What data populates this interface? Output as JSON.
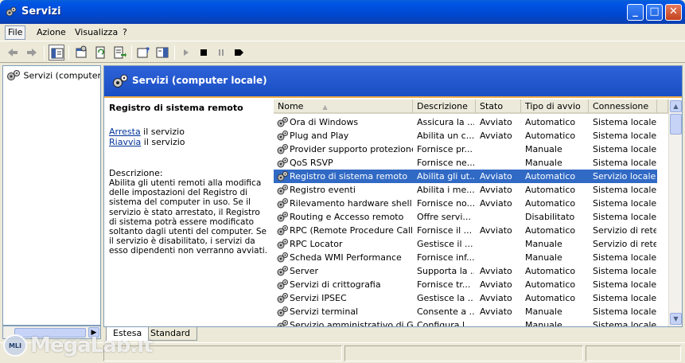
{
  "window": {
    "title": "Servizi"
  },
  "menu": [
    {
      "label": "File"
    },
    {
      "label": "Azione"
    },
    {
      "label": "Visualizza"
    },
    {
      "label": "?"
    }
  ],
  "tree": {
    "root": "Servizi (computer locale)"
  },
  "panel": {
    "header": "Servizi (computer locale)",
    "selected_name": "Registro di sistema remoto",
    "link_stop": "Arresta",
    "link_stop_suffix": " il servizio",
    "link_restart": "Riavvia",
    "link_restart_suffix": " il servizio",
    "description_label": "Descrizione:",
    "description": "Abilita gli utenti remoti alla modifica delle impostazioni del Registro di sistema del computer in uso. Se il servizio è stato arrestato, il Registro di sistema potrà essere modificato soltanto dagli utenti del computer. Se il servizio è disabilitato, i servizi da esso dipendenti non verranno avviati."
  },
  "columns": [
    "Nome",
    "Descrizione",
    "Stato",
    "Tipo di avvio",
    "Connessione"
  ],
  "rows": [
    {
      "name": "Ora di Windows",
      "desc": "Assicura la ...",
      "stato": "Avviato",
      "tipo": "Automatico",
      "conn": "Sistema locale",
      "selected": false
    },
    {
      "name": "Plug and Play",
      "desc": "Abilita un c...",
      "stato": "Avviato",
      "tipo": "Automatico",
      "conn": "Sistema locale",
      "selected": false
    },
    {
      "name": "Provider supporto protezione...",
      "desc": "Fornisce pr...",
      "stato": "",
      "tipo": "Manuale",
      "conn": "Sistema locale",
      "selected": false
    },
    {
      "name": "QoS RSVP",
      "desc": "Fornisce ne...",
      "stato": "",
      "tipo": "Manuale",
      "conn": "Sistema locale",
      "selected": false
    },
    {
      "name": "Registro di sistema remoto",
      "desc": "Abilita gli ut...",
      "stato": "Avviato",
      "tipo": "Automatico",
      "conn": "Servizio locale",
      "selected": true
    },
    {
      "name": "Registro eventi",
      "desc": "Abilita i me...",
      "stato": "Avviato",
      "tipo": "Automatico",
      "conn": "Sistema locale",
      "selected": false
    },
    {
      "name": "Rilevamento hardware shell",
      "desc": "Fornisce no...",
      "stato": "Avviato",
      "tipo": "Automatico",
      "conn": "Sistema locale",
      "selected": false
    },
    {
      "name": "Routing e Accesso remoto",
      "desc": "Offre servi...",
      "stato": "",
      "tipo": "Disabilitato",
      "conn": "Sistema locale",
      "selected": false
    },
    {
      "name": "RPC (Remote Procedure Call)",
      "desc": "Fornisce il ...",
      "stato": "Avviato",
      "tipo": "Automatico",
      "conn": "Servizio di rete",
      "selected": false
    },
    {
      "name": "RPC Locator",
      "desc": "Gestisce il ...",
      "stato": "",
      "tipo": "Manuale",
      "conn": "Servizio di rete",
      "selected": false
    },
    {
      "name": "Scheda WMI Performance",
      "desc": "Fornisce inf...",
      "stato": "",
      "tipo": "Manuale",
      "conn": "Sistema locale",
      "selected": false
    },
    {
      "name": "Server",
      "desc": "Supporta la ...",
      "stato": "Avviato",
      "tipo": "Automatico",
      "conn": "Sistema locale",
      "selected": false
    },
    {
      "name": "Servizi di crittografia",
      "desc": "Fornisce tr...",
      "stato": "Avviato",
      "tipo": "Automatico",
      "conn": "Sistema locale",
      "selected": false
    },
    {
      "name": "Servizi IPSEC",
      "desc": "Gestisce la ...",
      "stato": "Avviato",
      "tipo": "Automatico",
      "conn": "Sistema locale",
      "selected": false
    },
    {
      "name": "Servizi terminal",
      "desc": "Consente a ...",
      "stato": "Avviato",
      "tipo": "Manuale",
      "conn": "Sistema locale",
      "selected": false
    },
    {
      "name": "Servizio amministrativo di Ge...",
      "desc": "Configura l...",
      "stato": "",
      "tipo": "Manuale",
      "conn": "Sistema locale",
      "selected": false
    }
  ],
  "tabs": [
    "Estesa",
    "Standard"
  ],
  "watermark": {
    "text": "MegaLab.it",
    "badge": "MLI"
  },
  "colors": {
    "selection": "#316ac5",
    "header_blue": "#1a4fc4",
    "accent_orange": "#f3b049"
  }
}
